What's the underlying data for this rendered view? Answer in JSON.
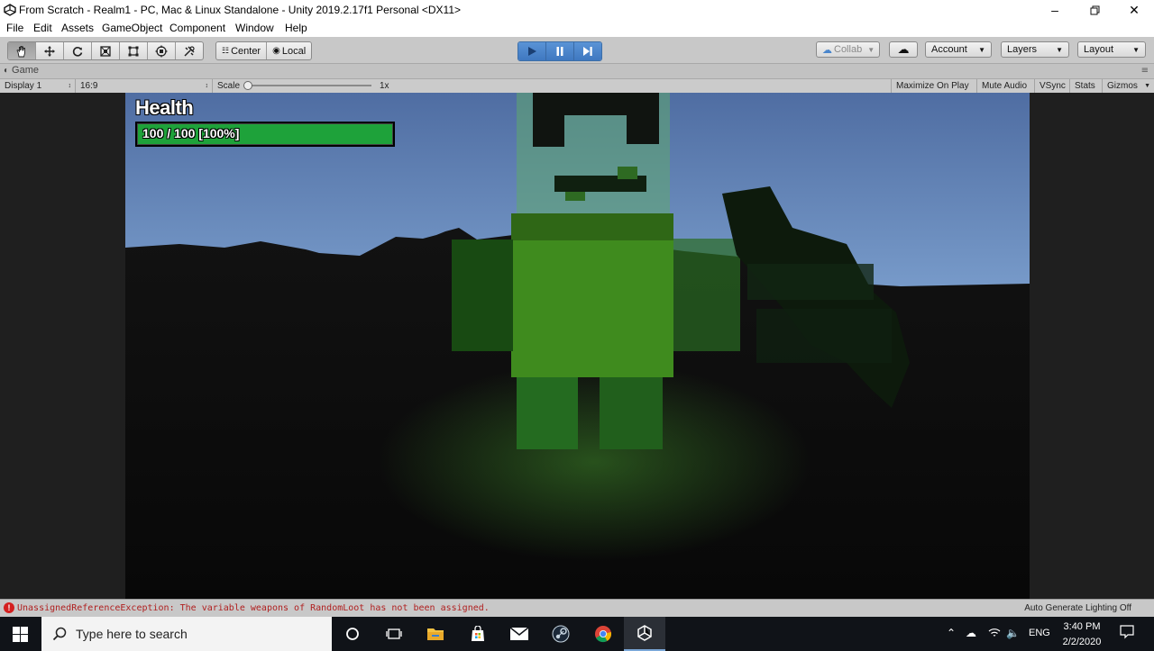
{
  "window": {
    "title": "From Scratch - Realm1 - PC, Mac & Linux Standalone - Unity 2019.2.17f1 Personal <DX11>",
    "controls": [
      "minimize-icon",
      "restore-icon",
      "close-icon"
    ]
  },
  "menubar": [
    "File",
    "Edit",
    "Assets",
    "GameObject",
    "Component",
    "Window",
    "Help"
  ],
  "toolbar": {
    "transform_tools": [
      "hand-icon",
      "move-icon",
      "rotate-icon",
      "scale-icon",
      "rect-tool-icon",
      "transform-icon",
      "custom-tool-icon"
    ],
    "pivot_center": "Center",
    "pivot_local": "Local",
    "play_controls": [
      "play-icon",
      "pause-icon",
      "step-icon"
    ],
    "collab": "Collab",
    "account": "Account",
    "layers": "Layers",
    "layout": "Layout"
  },
  "game_tab": {
    "label": "Game"
  },
  "game_bar": {
    "display": "Display 1",
    "aspect": "16:9",
    "scale_label": "Scale",
    "scale_value": "1x",
    "maximize_on_play": "Maximize On Play",
    "mute_audio": "Mute Audio",
    "vsync": "VSync",
    "stats": "Stats",
    "gizmos": "Gizmos"
  },
  "hud": {
    "health_title": "Health",
    "health_text": "100 / 100 [100%]",
    "health_fraction": 1.0
  },
  "statusbar": {
    "error": "UnassignedReferenceException: The variable weapons of RandomLoot has not been assigned.",
    "lighting": "Auto Generate Lighting Off"
  },
  "taskbar": {
    "search_placeholder": "Type here to search",
    "apps": [
      "cortana-icon",
      "task-view-icon",
      "file-explorer-icon",
      "microsoft-store-icon",
      "mail-icon",
      "steam-icon",
      "chrome-icon",
      "unity-icon"
    ],
    "language": "ENG",
    "time": "3:40 PM",
    "date": "2/2/2020"
  },
  "colors": {
    "play_active": "#4a86cc",
    "health_fill": "#1ea23a",
    "error_text": "#b02020",
    "taskbar": "#101318"
  }
}
